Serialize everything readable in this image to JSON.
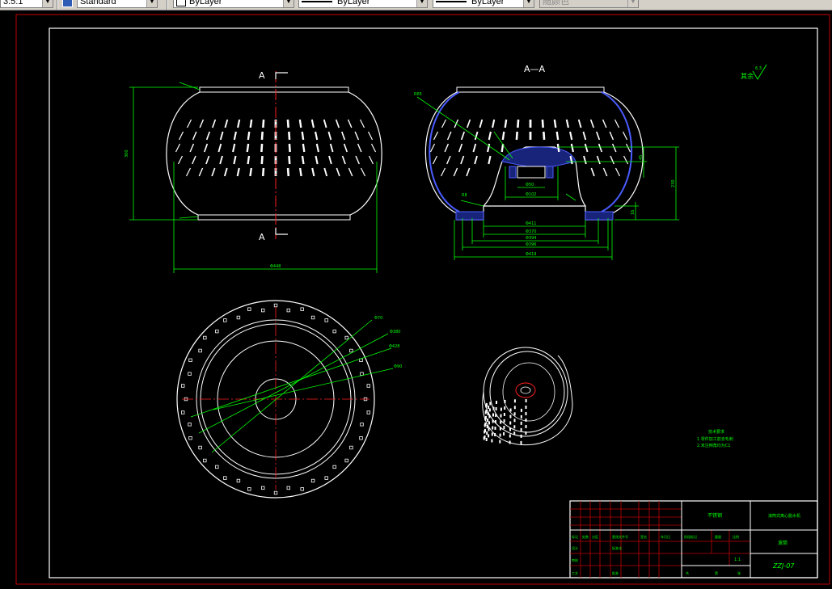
{
  "toolbar": {
    "scale_value": "3:5:1",
    "textstyle_value": "Standard",
    "layer_value": "ByLayer",
    "linetype_value": "ByLayer",
    "lineweight_value": "ByLayer",
    "color_value": "随颜色"
  },
  "drawing": {
    "section_label": "A",
    "section_title": "A—A",
    "roughness_note": "其余",
    "roughness_value": "6.3",
    "tech_title": "技术要求",
    "tech_line1": "1.零件加工前去毛刺",
    "tech_line2": "2.未注倒角均为C1",
    "dims": {
      "width_front": "Φ448",
      "height_front": "300",
      "section_d1": "Φ50",
      "section_d2": "Φ102",
      "section_d3": "Φ411",
      "section_d4": "Φ370",
      "section_d5": "Φ394",
      "section_d6": "Φ396",
      "section_d7": "Φ419",
      "section_r1": "R65",
      "section_r2": "R8",
      "section_h1": "45",
      "section_h2": "16",
      "section_h3": "230",
      "plan_d1": "Φ70",
      "plan_d2": "Φ380",
      "plan_d3": "Φ428",
      "plan_d4": "Φ90"
    },
    "title_block": {
      "material": "不锈钢",
      "part_name": "滚筒式离心脱水机",
      "designation": "ZZJ-07",
      "drawing_type": "滚筒",
      "scale": "1:1",
      "mark": "标记",
      "count": "处数",
      "zone": "分区",
      "change_doc": "更改文件号",
      "signature": "签名",
      "date": "年月日",
      "designer": "设计",
      "standardize": "标准化",
      "checker": "审核",
      "process": "工艺",
      "approve": "批准",
      "stage_mark": "阶段标记",
      "weight": "重量",
      "ratio": "比例",
      "sheet_total": "共",
      "sheet_num": "第",
      "sheets": "张"
    }
  }
}
